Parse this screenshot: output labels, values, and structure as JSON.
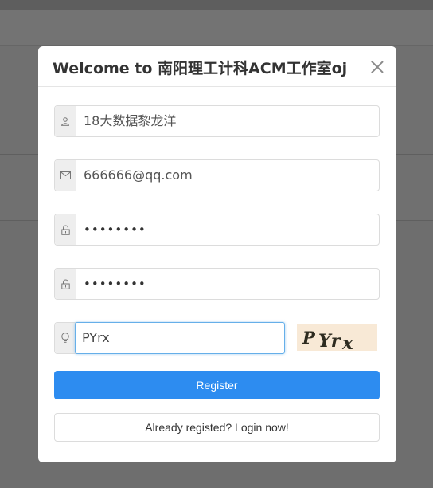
{
  "modal": {
    "title": "Welcome to 南阳理工计科ACM工作室oj"
  },
  "form": {
    "username": {
      "value": "18大数据黎龙洋",
      "icon": "user-icon"
    },
    "email": {
      "value": "666666@qq.com",
      "icon": "mail-icon"
    },
    "password": {
      "value": "••••••••",
      "icon": "lock-icon"
    },
    "password_again": {
      "value": "••••••••",
      "icon": "lock-icon"
    },
    "captcha": {
      "value": "PYrx",
      "icon": "bulb-icon",
      "image_text": "P Yr x"
    }
  },
  "buttons": {
    "register": "Register",
    "login": "Already registed? Login now!"
  },
  "colors": {
    "primary": "#2d8cf0",
    "focus_border": "#66afe9",
    "captcha_bg": "#f8e9d6"
  }
}
